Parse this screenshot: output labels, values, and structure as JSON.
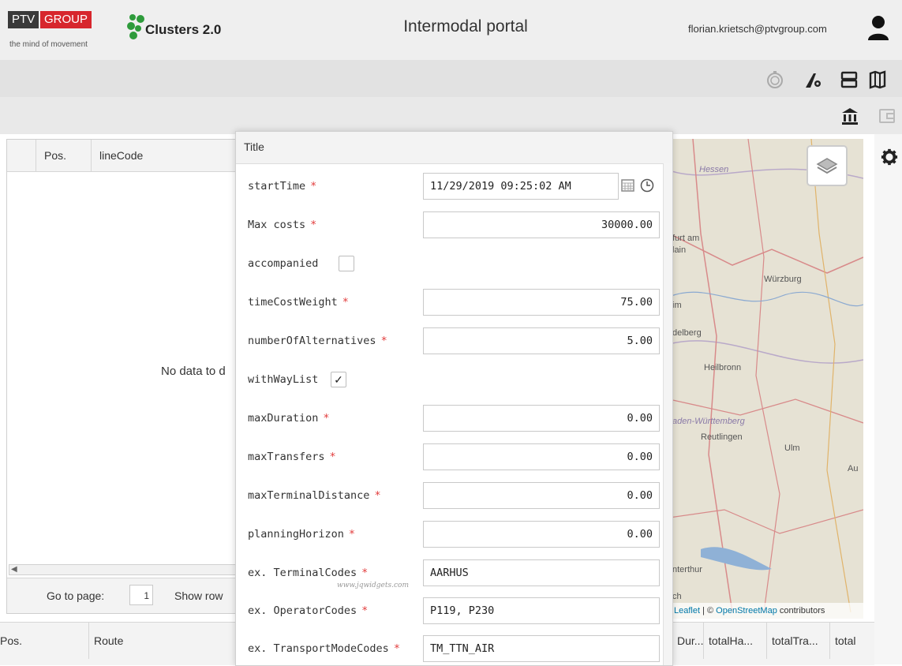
{
  "header": {
    "logo_ptv": "PTV",
    "logo_group": "GROUP",
    "logo_tagline": "the mind of movement",
    "clusters_title": "Clusters 2.0",
    "app_title": "Intermodal portal",
    "user_email": "florian.krietsch@ptvgroup.com"
  },
  "grid": {
    "columns": [
      "Pos.",
      "lineCode"
    ],
    "empty_text": "No data to d",
    "pager_label": "Go to page:",
    "page_number": "1",
    "rows_label": "Show row"
  },
  "bottom_grid": {
    "columns": [
      "Pos.",
      "Route",
      "Dur...",
      "totalHa...",
      "totalTra...",
      "total"
    ]
  },
  "map": {
    "labels": [
      "Hessen",
      "furt am",
      "lain",
      "Würzburg",
      "im",
      "delberg",
      "Heilbronn",
      "aden-Württemberg",
      "Reutlingen",
      "Ulm",
      "Au",
      "nterthur",
      "ch"
    ],
    "attribution_leaflet": "Leaflet",
    "attribution_sep": " | © ",
    "attribution_osm": "OpenStreetMap",
    "attribution_tail": " contributors"
  },
  "dialog": {
    "title": "Title",
    "watermark": "www.jqwidgets.com",
    "fields": [
      {
        "label": "startTime",
        "required": "*",
        "value": "11/29/2019 09:25:02 AM"
      },
      {
        "label": "Max costs",
        "required": "*",
        "value": "30000.00"
      },
      {
        "label": "accompanied",
        "required": "",
        "checked": ""
      },
      {
        "label": "timeCostWeight",
        "required": "*",
        "value": "75.00"
      },
      {
        "label": "numberOfAlternatives",
        "required": "*",
        "value": "5.00"
      },
      {
        "label": "withWayList",
        "required": "",
        "checked": "✓"
      },
      {
        "label": "maxDuration",
        "required": "*",
        "value": "0.00"
      },
      {
        "label": "maxTransfers",
        "required": "*",
        "value": "0.00"
      },
      {
        "label": "maxTerminalDistance",
        "required": "*",
        "value": "0.00"
      },
      {
        "label": "planningHorizon",
        "required": "*",
        "value": "0.00"
      },
      {
        "label": "ex. TerminalCodes",
        "required": "*",
        "value": "AARHUS"
      },
      {
        "label": "ex. OperatorCodes",
        "required": "*",
        "value": "P119, P230"
      },
      {
        "label": "ex. TransportModeCodes",
        "required": "*",
        "value": "TM_TTN_AIR"
      }
    ]
  },
  "icons": {
    "toolbar1": [
      "stopwatch-icon",
      "route-settings-icon",
      "server-icon",
      "map-icon"
    ],
    "toolbar2": [
      "bank-icon",
      "wallet-icon"
    ],
    "sidebar": [
      "gear-icon"
    ]
  },
  "colors": {
    "ptv_red": "#d7262d",
    "ptv_dark": "#3a3a3a",
    "clusters_green": "#2e9b3b",
    "required_star": "#e23c3c",
    "link_blue": "#0078a8"
  }
}
